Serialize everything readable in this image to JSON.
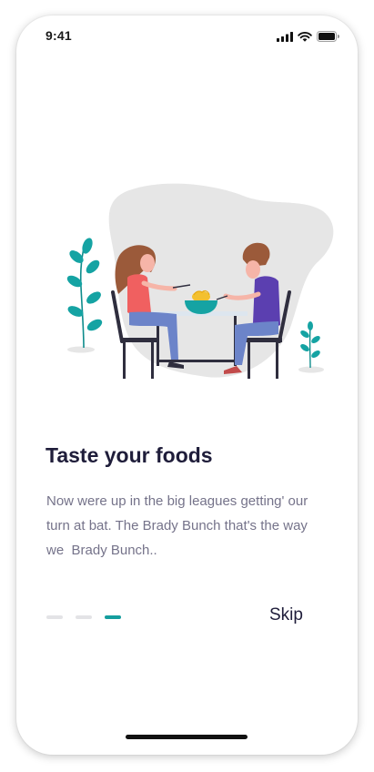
{
  "status_bar": {
    "time": "9:41",
    "icons": [
      "signal-icon",
      "wifi-icon",
      "battery-icon"
    ]
  },
  "illustration": {
    "name": "couple-eating-noodles",
    "colors": {
      "blob": "#e6e6e6",
      "teal": "#15a3a3",
      "woman_top": "#f06060",
      "man_top": "#5b3fb0",
      "pants": "#6c84c9",
      "hair": "#9b5a3a",
      "furniture": "#2f2e3e",
      "table_top": "#dde6ef"
    }
  },
  "onboarding": {
    "title": "Taste your foods",
    "description": "Now were up in the big leagues getting' our turn at bat. The Brady Bunch that's the way we  Brady Bunch..",
    "page_count": 3,
    "active_page": 3,
    "skip_label": "Skip"
  },
  "theme": {
    "accent": "#159e9e",
    "text_primary": "#1f1d3a",
    "text_secondary": "#75738a",
    "inactive_dot": "#e3e3e6"
  }
}
